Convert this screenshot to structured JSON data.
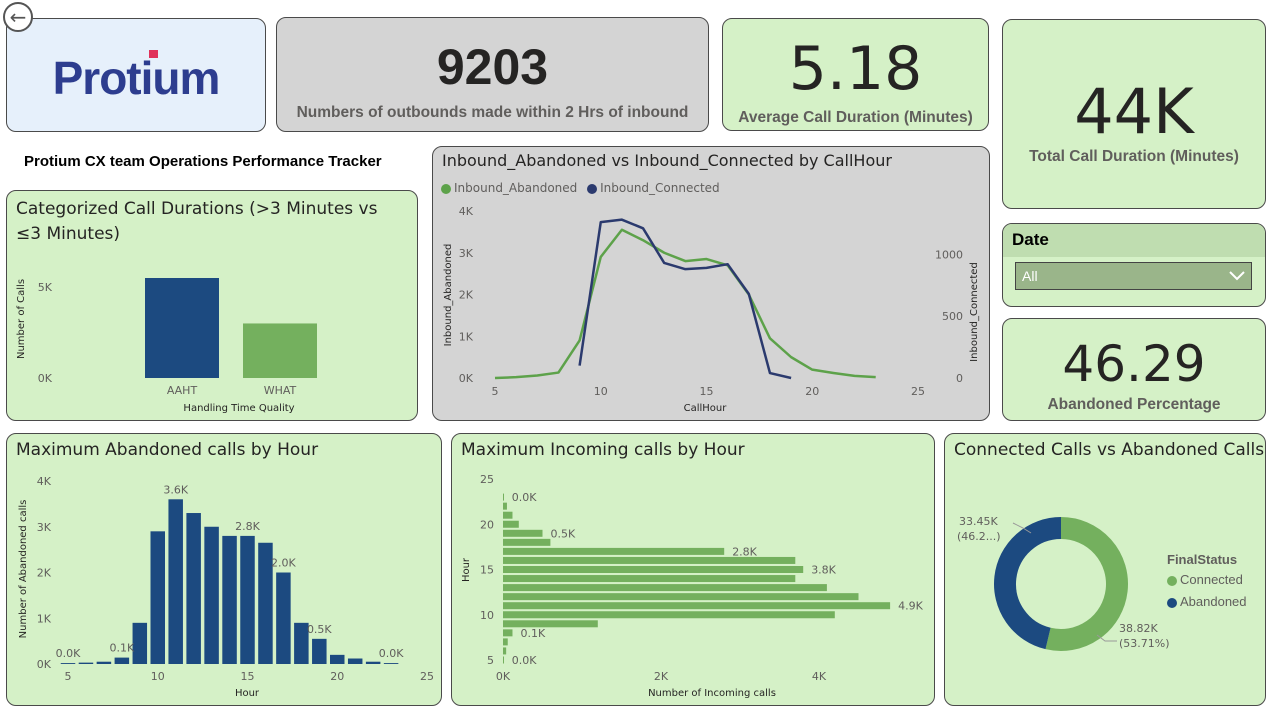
{
  "nav": {
    "back_icon": "back-arrow-icon"
  },
  "logo": {
    "text": "Protium"
  },
  "page_subtitle": "Protium CX team Operations Performance Tracker",
  "kpis": {
    "outbounds": {
      "value": "9203",
      "label": "Numbers of outbounds made within 2 Hrs of inbound"
    },
    "avg_duration": {
      "value": "5.18",
      "label": "Average Call Duration (Minutes)"
    },
    "total_duration": {
      "value": "44K",
      "label": "Total Call Duration (Minutes)"
    },
    "abandoned_pct": {
      "value": "46.29",
      "label": "Abandoned Percentage"
    }
  },
  "slicer": {
    "title": "Date",
    "selected": "All",
    "icon": "chevron-down-icon"
  },
  "colors": {
    "green": "#74b05e",
    "navy": "#1c4a80",
    "line_green": "#5da24a",
    "line_navy": "#2b3a6e"
  },
  "chart_data": [
    {
      "id": "categorized_durations",
      "type": "bar",
      "title": "Categorized Call Durations (>3 Minutes vs ≤3 Minutes)",
      "xlabel": "Handling Time Quality",
      "ylabel": "Number of Calls",
      "categories": [
        "AAHT",
        "WHAT"
      ],
      "values": [
        5500,
        3000
      ],
      "ylim": [
        0,
        5500
      ],
      "yticks": [
        {
          "v": 0,
          "label": "0K"
        },
        {
          "v": 5000,
          "label": "5K"
        }
      ],
      "bar_colors": [
        "#1c4a80",
        "#74b05e"
      ]
    },
    {
      "id": "inbound_lines",
      "type": "line",
      "title": "Inbound_Abandoned vs Inbound_Connected by CallHour",
      "xlabel": "CallHour",
      "ylabel": "Inbound_Abandoned",
      "y2label": "Inbound_Connected",
      "xlim": [
        5,
        25
      ],
      "xticks": [
        5,
        10,
        15,
        20,
        25
      ],
      "ylim": [
        0,
        4000
      ],
      "yticks": [
        {
          "v": 0,
          "label": "0K"
        },
        {
          "v": 1000,
          "label": "1K"
        },
        {
          "v": 2000,
          "label": "2K"
        },
        {
          "v": 3000,
          "label": "3K"
        },
        {
          "v": 4000,
          "label": "4K"
        }
      ],
      "y2lim": [
        0,
        1350
      ],
      "y2ticks": [
        0,
        500,
        1000
      ],
      "series": [
        {
          "name": "Inbound_Abandoned",
          "axis": "left",
          "color": "#5da24a",
          "x": [
            5,
            6,
            7,
            8,
            9,
            10,
            11,
            12,
            13,
            14,
            15,
            16,
            17,
            18,
            19,
            20,
            21,
            22,
            23
          ],
          "y": [
            0,
            20,
            60,
            130,
            900,
            2900,
            3550,
            3300,
            3000,
            2800,
            2850,
            2700,
            2000,
            950,
            500,
            200,
            120,
            50,
            20
          ]
        },
        {
          "name": "Inbound_Connected",
          "axis": "right",
          "color": "#2b3a6e",
          "x": [
            9,
            10,
            11,
            12,
            13,
            14,
            15,
            16,
            17,
            18,
            19
          ],
          "y": [
            100,
            1260,
            1280,
            1210,
            930,
            880,
            890,
            920,
            680,
            40,
            0
          ]
        }
      ]
    },
    {
      "id": "max_abandoned",
      "type": "bar",
      "title": "Maximum Abandoned calls by Hour",
      "xlabel": "Hour",
      "ylabel": "Number of Abandoned calls",
      "xlim": [
        5,
        25
      ],
      "xticks": [
        5,
        10,
        15,
        20,
        25
      ],
      "ylim": [
        0,
        4000
      ],
      "yticks": [
        {
          "v": 0,
          "label": "0K"
        },
        {
          "v": 1000,
          "label": "1K"
        },
        {
          "v": 2000,
          "label": "2K"
        },
        {
          "v": 3000,
          "label": "3K"
        },
        {
          "v": 4000,
          "label": "4K"
        }
      ],
      "x": [
        5,
        6,
        7,
        8,
        9,
        10,
        11,
        12,
        13,
        14,
        15,
        16,
        17,
        18,
        19,
        20,
        21,
        22,
        23
      ],
      "values": [
        20,
        30,
        50,
        140,
        900,
        2900,
        3600,
        3300,
        3000,
        2800,
        2800,
        2650,
        2000,
        900,
        550,
        200,
        120,
        50,
        20
      ],
      "data_labels": [
        {
          "x": 5,
          "label": "0.0K"
        },
        {
          "x": 8,
          "label": "0.1K"
        },
        {
          "x": 11,
          "label": "3.6K"
        },
        {
          "x": 15,
          "label": "2.8K"
        },
        {
          "x": 17,
          "label": "2.0K"
        },
        {
          "x": 19,
          "label": "0.5K"
        },
        {
          "x": 23,
          "label": "0.0K"
        }
      ],
      "color": "#1c4a80"
    },
    {
      "id": "max_incoming",
      "type": "bar",
      "orientation": "horizontal",
      "title": "Maximum Incoming calls by Hour",
      "xlabel": "Number of Incoming calls",
      "ylabel": "Hour",
      "ylim": [
        5,
        25
      ],
      "yticks": [
        5,
        10,
        15,
        20,
        25
      ],
      "xlim": [
        0,
        5000
      ],
      "xticks": [
        {
          "v": 0,
          "label": "0K"
        },
        {
          "v": 2000,
          "label": "2K"
        },
        {
          "v": 4000,
          "label": "4K"
        }
      ],
      "y": [
        5,
        6,
        7,
        8,
        9,
        10,
        11,
        12,
        13,
        14,
        15,
        16,
        17,
        18,
        19,
        20,
        21,
        22,
        23
      ],
      "values": [
        10,
        40,
        60,
        120,
        1200,
        4200,
        4900,
        4500,
        4100,
        3700,
        3800,
        3700,
        2800,
        600,
        500,
        200,
        120,
        50,
        10
      ],
      "data_labels": [
        {
          "y": 5,
          "label": "0.0K"
        },
        {
          "y": 8,
          "label": "0.1K"
        },
        {
          "y": 11,
          "label": "4.9K"
        },
        {
          "y": 15,
          "label": "3.8K"
        },
        {
          "y": 17,
          "label": "2.8K"
        },
        {
          "y": 19,
          "label": "0.5K"
        },
        {
          "y": 23,
          "label": "0.0K"
        }
      ],
      "color": "#74b05e"
    },
    {
      "id": "connected_vs_abandoned",
      "type": "pie",
      "title": "Connected Calls vs Abandoned Calls",
      "legend_title": "FinalStatus",
      "slices": [
        {
          "name": "Connected",
          "value": 38820,
          "label": "38.82K",
          "pct": "(53.71%)",
          "color": "#74b05e"
        },
        {
          "name": "Abandoned",
          "value": 33450,
          "label": "33.45K",
          "pct": "(46.2...)",
          "color": "#1c4a80"
        }
      ]
    }
  ]
}
